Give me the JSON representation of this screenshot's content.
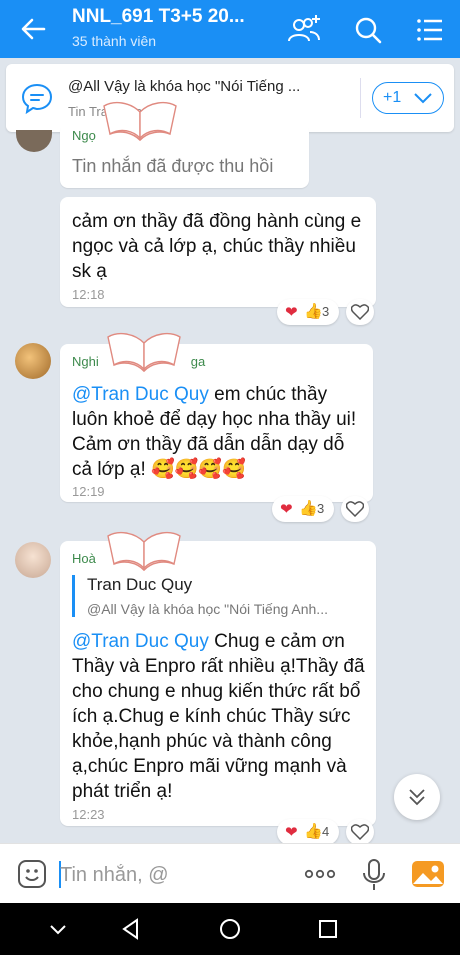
{
  "header": {
    "title": "NNL_691 T3+5 20...",
    "members": "35 thành viên"
  },
  "pinned": {
    "text": "@All Vậy là khóa học \"Nói Tiếng ...",
    "sender": "Tin        Tran Duc Quy",
    "more": "+1"
  },
  "messages": [
    {
      "sender": "Ngọ",
      "recalled": "Tin nhắn đã được thu hồi"
    },
    {
      "text": "cảm ơn thầy đã đồng hành cùng e ngọc và cả lớp ạ, chúc thầy nhiều sk ạ",
      "time": "12:18",
      "reactions": "3"
    },
    {
      "sender": "Nghi",
      "sender_suffix": "ga",
      "mention": "@Tran Duc Quy",
      "text": "  em chúc thầy luôn khoẻ để dạy học nha thầy ui! Cảm ơn thầy đã dẫn dẫn dạy dỗ cả lớp ạ! 🥰🥰🥰🥰",
      "time": "12:19",
      "reactions": "3"
    },
    {
      "sender": "Hoà",
      "quote_name": "Tran Duc Quy",
      "quote_text": "@All Vậy là khóa học \"Nói Tiếng Anh...",
      "mention": "@Tran Duc Quy",
      "text": " Chug e cảm ơn Thầy và Enpro rất nhiều ạ!Thầy đã cho chung e nhug kiến thức rất bổ ích ạ.Chug e kính chúc Thầy sức khỏe,hạnh phúc và thành công ạ,chúc Enpro mãi vững mạnh và phát triển ạ!",
      "time": "12:23",
      "reactions": "4"
    }
  ],
  "input": {
    "placeholder": "Tin nhắn, @"
  },
  "colors": {
    "primary": "#1a8ff5",
    "chat_bg": "#dfe5ec",
    "heart": "#e02c3f"
  },
  "icons": [
    "back-arrow-icon",
    "add-member-icon",
    "search-icon",
    "menu-list-icon",
    "chat-bubble-icon",
    "chevron-down-icon",
    "heart-icon",
    "thumbs-up-icon",
    "like-outline-icon",
    "double-chevron-down-icon",
    "sticker-icon",
    "more-dots-icon",
    "microphone-icon",
    "gallery-icon",
    "nav-back-icon",
    "nav-home-icon",
    "nav-recents-icon",
    "nav-dropdown-icon",
    "open-book-icon"
  ]
}
